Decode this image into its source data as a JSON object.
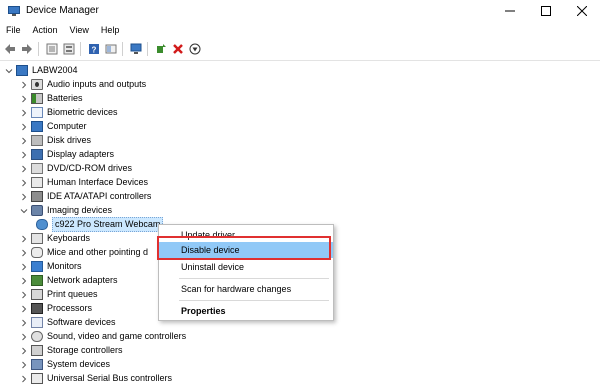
{
  "window": {
    "title": "Device Manager",
    "icon": "device-manager-icon"
  },
  "menubar": {
    "items": [
      "File",
      "Action",
      "View",
      "Help"
    ]
  },
  "toolbar": {
    "icons": [
      "back-arrow-icon",
      "forward-arrow-icon",
      "tree-view-icon",
      "properties-icon",
      "help-icon",
      "view-icon",
      "monitor-icon",
      "update-driver-icon",
      "uninstall-x-icon",
      "disable-down-icon"
    ]
  },
  "tree": {
    "root": "LABW2004",
    "categories": [
      "Audio inputs and outputs",
      "Batteries",
      "Biometric devices",
      "Computer",
      "Disk drives",
      "Display adapters",
      "DVD/CD-ROM drives",
      "Human Interface Devices",
      "IDE ATA/ATAPI controllers",
      "Imaging devices",
      "c922 Pro Stream Webcam",
      "Keyboards",
      "Mice and other pointing d",
      "Monitors",
      "Network adapters",
      "Print queues",
      "Processors",
      "Software devices",
      "Sound, video and game controllers",
      "Storage controllers",
      "System devices",
      "Universal Serial Bus controllers"
    ]
  },
  "context_menu": {
    "items": [
      "Update driver",
      "Disable device",
      "Uninstall device",
      "Scan for hardware changes",
      "Properties"
    ],
    "highlighted": "Disable device"
  },
  "colors": {
    "highlight": "#91c9f7",
    "red_box": "#e03030",
    "selection": "#cce8ff"
  }
}
